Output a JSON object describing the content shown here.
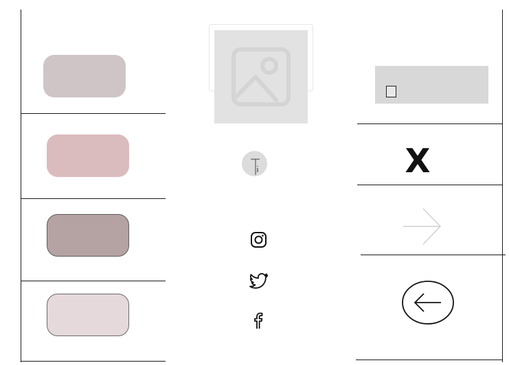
{
  "swatches": [
    {
      "name": "swatch-1",
      "color": "#cfc5c6"
    },
    {
      "name": "swatch-2",
      "color": "#dbbcbe"
    },
    {
      "name": "swatch-3",
      "color": "#b5a2a3"
    },
    {
      "name": "swatch-4",
      "color": "#e5d9db"
    }
  ],
  "icons": {
    "image": "image-placeholder-icon",
    "avatar": "user-avatar-icon",
    "instagram": "instagram-icon",
    "twitter": "twitter-icon",
    "facebook": "facebook-icon",
    "close": "close-icon",
    "arrow_right": "arrow-right-icon",
    "arrow_left": "arrow-left-circle-icon"
  },
  "close_label": "X"
}
